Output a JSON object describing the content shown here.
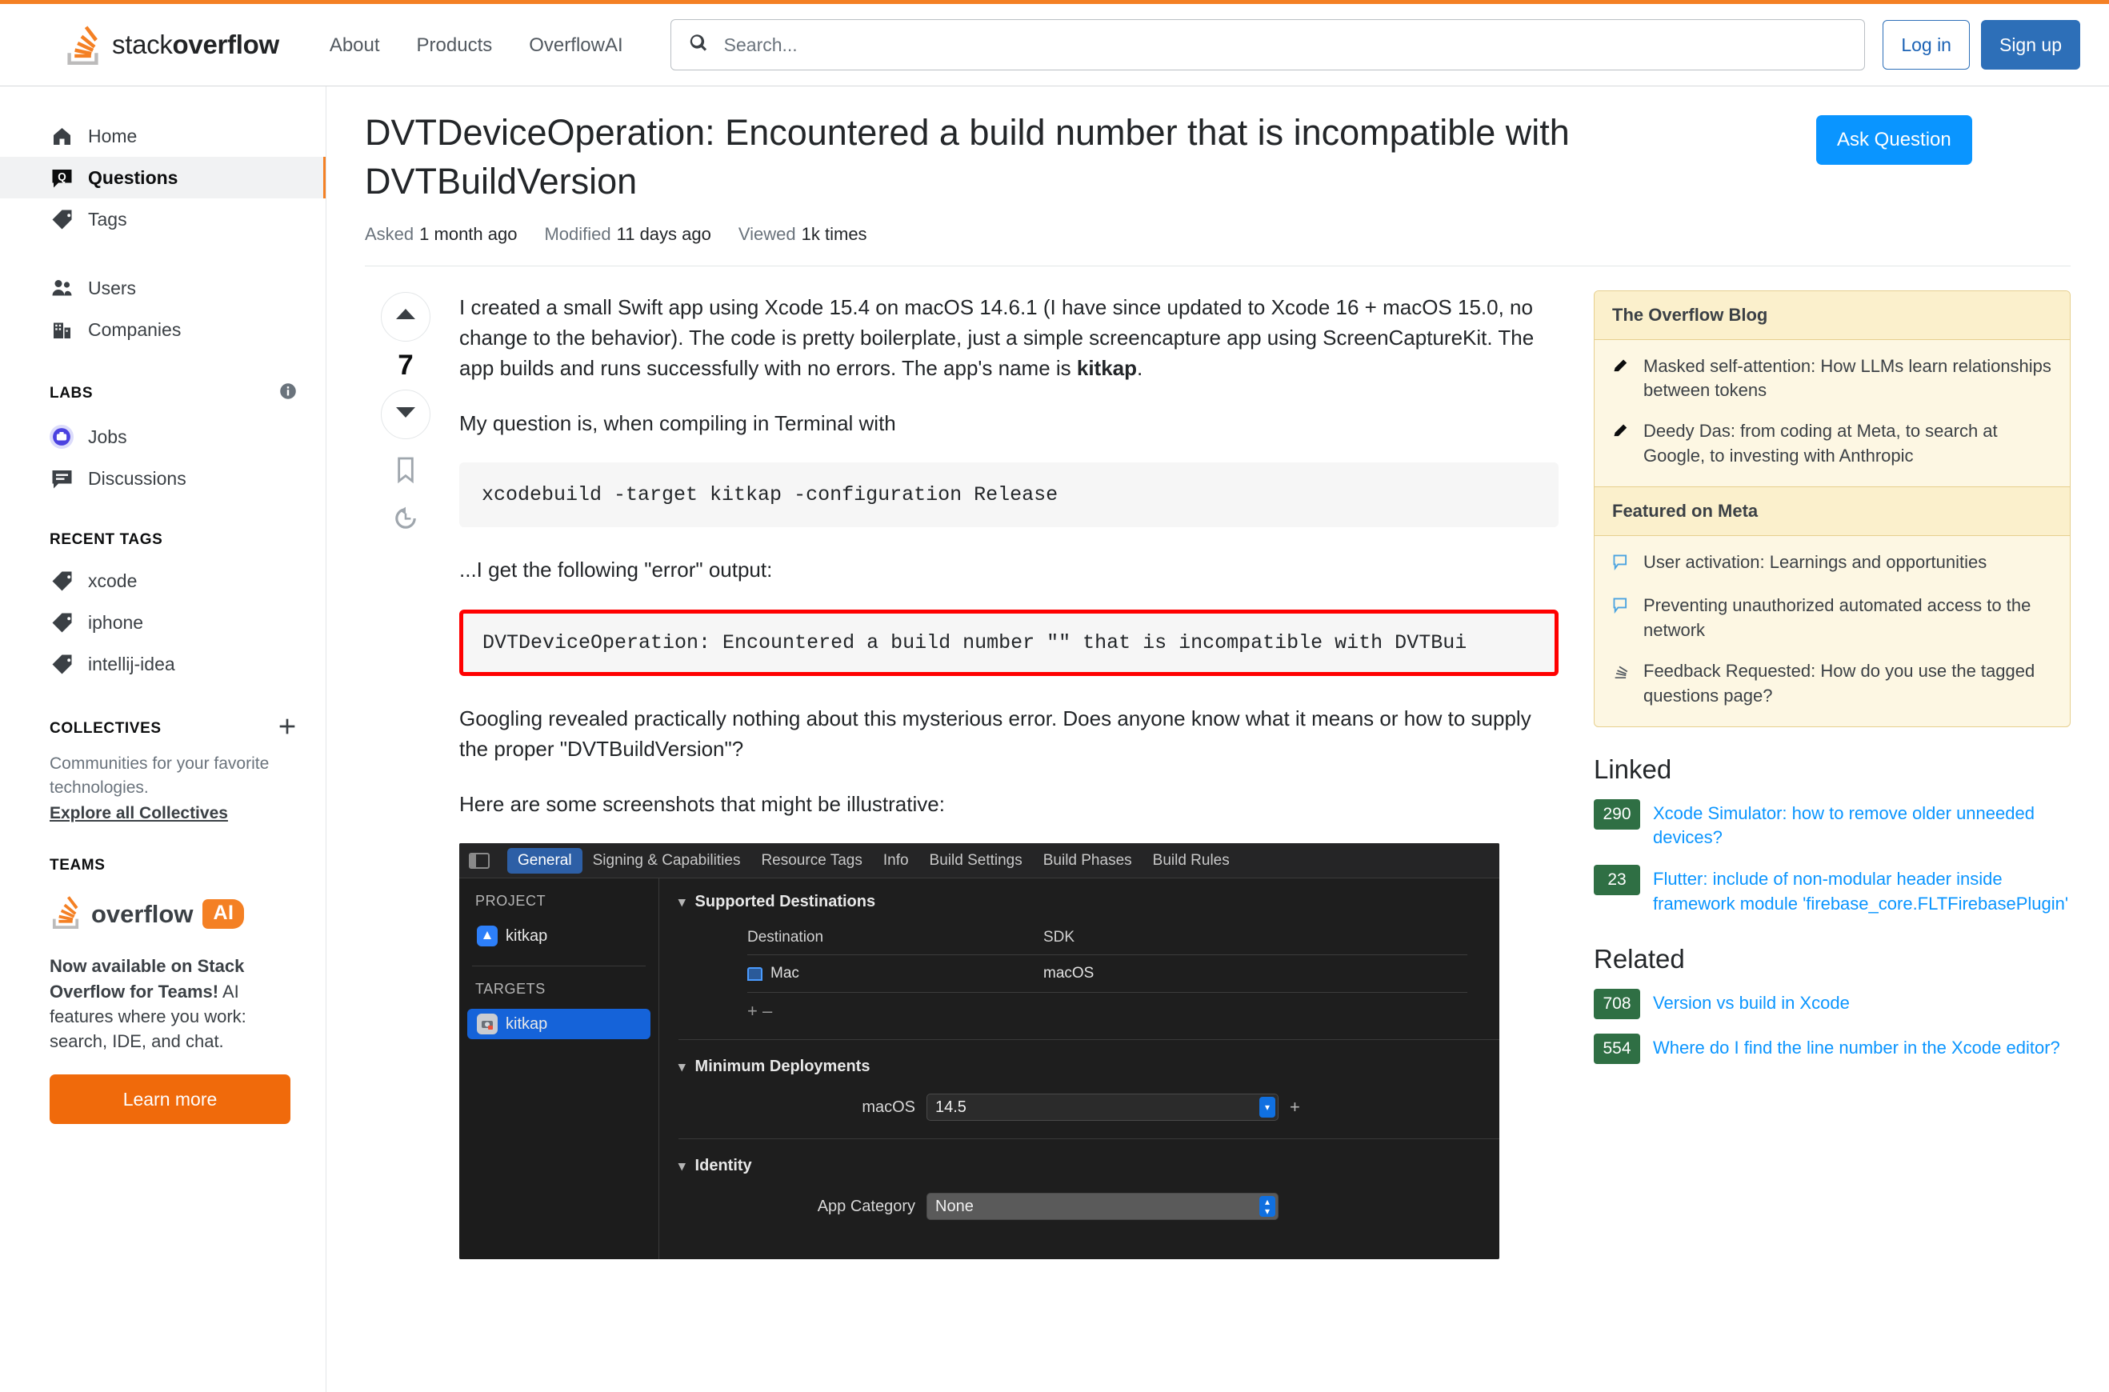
{
  "brand": {
    "accent_orange": "#f48024",
    "link_blue": "#0a95ff",
    "score_green": "#2f6f44"
  },
  "header": {
    "logo_text_light": "stack",
    "logo_text_bold": "overflow",
    "nav": [
      {
        "label": "About"
      },
      {
        "label": "Products"
      },
      {
        "label": "OverflowAI"
      }
    ],
    "search": {
      "placeholder": "Search...",
      "value": "",
      "icon": "search-icon"
    },
    "login_label": "Log in",
    "signup_label": "Sign up"
  },
  "sidebar": {
    "items": [
      {
        "label": "Home",
        "icon": "home-icon",
        "active": false
      },
      {
        "label": "Questions",
        "icon": "question-bubble-icon",
        "active": true
      },
      {
        "label": "Tags",
        "icon": "tag-icon",
        "active": false
      },
      {
        "label": "Users",
        "icon": "users-icon",
        "active": false
      },
      {
        "label": "Companies",
        "icon": "building-icon",
        "active": false
      }
    ],
    "labs_heading": "LABS",
    "labs_info_icon": "info-icon",
    "labs_items": [
      {
        "label": "Jobs",
        "icon": "briefcase-icon"
      },
      {
        "label": "Discussions",
        "icon": "discussion-icon"
      }
    ],
    "recent_tags_heading": "RECENT TAGS",
    "recent_tags": [
      {
        "label": "xcode",
        "icon": "tag-icon"
      },
      {
        "label": "iphone",
        "icon": "tag-icon"
      },
      {
        "label": "intellij-idea",
        "icon": "tag-icon"
      }
    ],
    "collectives_heading": "COLLECTIVES",
    "collectives_add_icon": "plus-icon",
    "collectives_desc": "Communities for your favorite technologies.",
    "collectives_link": "Explore all Collectives",
    "teams_heading": "TEAMS",
    "teams_logo_text": "overflow",
    "teams_logo_badge": "AI",
    "teams_desc_bold": "Now available on Stack Overflow for Teams!",
    "teams_desc_rest": " AI features where you work: search, IDE, and chat.",
    "teams_button": "Learn more"
  },
  "question": {
    "title": "DVTDeviceOperation: Encountered a build number that is incompatible with DVTBuildVersion",
    "ask_button": "Ask Question",
    "meta": [
      {
        "label": "Asked",
        "value": "1 month ago"
      },
      {
        "label": "Modified",
        "value": "11 days ago"
      },
      {
        "label": "Viewed",
        "value": "1k times"
      }
    ],
    "vote": {
      "up_icon": "upvote-arrow-icon",
      "count": "7",
      "down_icon": "downvote-arrow-icon",
      "bookmark_icon": "bookmark-icon",
      "history_icon": "history-icon"
    },
    "body": {
      "para1_a": "I created a small Swift app using Xcode 15.4 on macOS 14.6.1 (I have since updated to Xcode 16 + macOS 15.0, no change to the behavior). The code is pretty boilerplate, just a simple screencapture app using ScreenCaptureKit. The app builds and runs successfully with no errors. The app's name is ",
      "para1_bold": "kitkap",
      "para1_b": ".",
      "para2": "My question is, when compiling in Terminal with",
      "code1": "xcodebuild -target kitkap -configuration Release",
      "para3": "...I get the following \"error\" output:",
      "code2": "DVTDeviceOperation: Encountered a build number \"\" that is incompatible with DVTBui",
      "para4": "Googling revealed practically nothing about this mysterious error. Does anyone know what it means or how to supply the proper \"DVTBuildVersion\"?",
      "para5": "Here are some screenshots that might be illustrative:"
    }
  },
  "xcode_screenshot": {
    "sidebar_toggle_icon": "sidebar-toggle-icon",
    "tabs": [
      {
        "label": "General",
        "selected": true
      },
      {
        "label": "Signing & Capabilities",
        "selected": false
      },
      {
        "label": "Resource Tags",
        "selected": false
      },
      {
        "label": "Info",
        "selected": false
      },
      {
        "label": "Build Settings",
        "selected": false
      },
      {
        "label": "Build Phases",
        "selected": false
      },
      {
        "label": "Build Rules",
        "selected": false
      }
    ],
    "project_heading": "PROJECT",
    "project_item": "kitkap",
    "targets_heading": "TARGETS",
    "target_item": "kitkap",
    "group_supported_destinations": "Supported Destinations",
    "table_headers": [
      "Destination",
      "SDK"
    ],
    "table_rows": [
      {
        "destination": "Mac",
        "sdk": "macOS"
      }
    ],
    "add_remove": "+  –",
    "group_minimum_deployments": "Minimum Deployments",
    "macos_label": "macOS",
    "macos_value": "14.5",
    "group_identity": "Identity",
    "app_category_label": "App Category",
    "app_category_value": "None"
  },
  "rightbar": {
    "blog_heading": "The Overflow Blog",
    "blog_items": [
      {
        "icon": "pencil-icon",
        "text": "Masked self-attention: How LLMs learn relationships between tokens"
      },
      {
        "icon": "pencil-icon",
        "text": "Deedy Das: from coding at Meta, to search at Google, to investing with Anthropic"
      }
    ],
    "meta_heading": "Featured on Meta",
    "meta_items": [
      {
        "icon": "comment-icon",
        "text": "User activation: Learnings and opportunities"
      },
      {
        "icon": "comment-icon",
        "text": "Preventing unauthorized automated access to the network"
      },
      {
        "icon": "stacks-icon",
        "text": "Feedback Requested: How do you use the tagged questions page?"
      }
    ],
    "linked_heading": "Linked",
    "linked_items": [
      {
        "score": "290",
        "title": "Xcode Simulator: how to remove older unneeded devices?"
      },
      {
        "score": "23",
        "title": "Flutter: include of non-modular header inside framework module 'firebase_core.FLTFirebasePlugin'"
      }
    ],
    "related_heading": "Related",
    "related_items": [
      {
        "score": "708",
        "title": "Version vs build in Xcode"
      },
      {
        "score": "554",
        "title": "Where do I find the line number in the Xcode editor?"
      }
    ]
  }
}
